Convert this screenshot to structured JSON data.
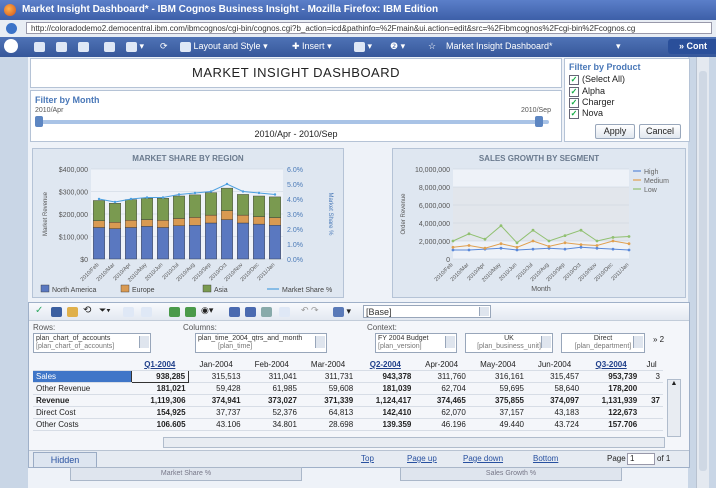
{
  "window": {
    "title": "Market Insight Dashboard* - IBM Cognos Business Insight - Mozilla Firefox: IBM Edition",
    "url": "http://coloradodemo2.democentral.ibm.com/ibmcognos/cgi-bin/cognos.cgi?b_action=icd&pathinfo=%2Fmain&ui.action=edit&src=%2Fibmcognos%2Fcgi-bin%2Fcognos.cg"
  },
  "toolbar": {
    "layout_style": "Layout and Style",
    "insert": "Insert",
    "doc_title": "Market Insight Dashboard*",
    "cont": "» Cont"
  },
  "header": {
    "title": "MARKET INSIGHT DASHBOARD"
  },
  "month_filter": {
    "label": "Filter by Month",
    "start": "2010/Apr",
    "end": "2010/Sep",
    "range": "2010/Apr - 2010/Sep"
  },
  "product_filter": {
    "label": "Filter by Product",
    "options": [
      {
        "label": "(Select All)",
        "checked": "✓"
      },
      {
        "label": "Alpha",
        "checked": "✓"
      },
      {
        "label": "Charger",
        "checked": "✓"
      },
      {
        "label": "Nova",
        "checked": "✓"
      }
    ],
    "apply": "Apply",
    "cancel": "Cancel"
  },
  "colors": {
    "north_america": "#5a78c0",
    "europe": "#d99a52",
    "asia": "#7a9a50",
    "market_share": "#4da0e0",
    "high": "#5a88d8",
    "medium": "#e0a050",
    "low": "#90c070"
  },
  "chart_data": [
    {
      "type": "bar",
      "title": "MARKET SHARE BY REGION",
      "ylabel": "Market Revenue",
      "y2label": "Market Share %",
      "ylim": [
        0,
        400000
      ],
      "y2lim": [
        0,
        6
      ],
      "yticks": [
        "$400,000",
        "$300,000",
        "$200,000",
        "$100,000",
        "$0"
      ],
      "y2ticks": [
        "6.0%",
        "5.0%",
        "4.0%",
        "3.0%",
        "2.0%",
        "1.0%",
        "0.0%"
      ],
      "categories": [
        "2010/Feb",
        "2010/Mar",
        "2010/Apr",
        "2010/May",
        "2010/Jun",
        "2010/Jul",
        "2010/Aug",
        "2010/Sep",
        "2010/Oct",
        "2010/Nov",
        "2010/Dec",
        "2011/Jan"
      ],
      "series": [
        {
          "name": "North America",
          "values": [
            140000,
            135000,
            140000,
            145000,
            140000,
            148000,
            150000,
            160000,
            175000,
            160000,
            155000,
            150000
          ]
        },
        {
          "name": "Europe",
          "values": [
            30000,
            28000,
            32000,
            30000,
            32000,
            32000,
            35000,
            35000,
            40000,
            35000,
            33000,
            34000
          ]
        },
        {
          "name": "Asia",
          "values": [
            90000,
            85000,
            92000,
            95000,
            98000,
            100000,
            100000,
            100000,
            100000,
            92000,
            92000,
            92000
          ]
        }
      ],
      "line": {
        "name": "Market Share %",
        "values": [
          4.0,
          3.8,
          4.0,
          4.1,
          4.1,
          4.3,
          4.4,
          4.5,
          5.0,
          4.5,
          4.4,
          4.3
        ]
      },
      "legend": [
        "North America",
        "Europe",
        "Asia",
        "Market Share %"
      ]
    },
    {
      "type": "line",
      "title": "SALES GROWTH BY SEGMENT",
      "ylabel": "Order Revenue",
      "xlabel": "Month",
      "ylim": [
        0,
        10000000
      ],
      "yticks": [
        "10,000,000",
        "8,000,000",
        "6,000,000",
        "4,000,000",
        "2,000,000",
        "0"
      ],
      "categories": [
        "2010/Feb",
        "2010/Mar",
        "2010/Apr",
        "2010/May",
        "2010/Jun",
        "2010/Jul",
        "2010/Aug",
        "2010/Sep",
        "2010/Oct",
        "2010/Nov",
        "2010/Dec",
        "2011/Jan"
      ],
      "series": [
        {
          "name": "High",
          "values": [
            1000000,
            1000000,
            1100000,
            1200000,
            1000000,
            1100000,
            1200000,
            1100000,
            1300000,
            1200000,
            1100000,
            1000000
          ]
        },
        {
          "name": "Medium",
          "values": [
            1300000,
            1500000,
            1200000,
            1700000,
            1300000,
            2000000,
            1400000,
            1800000,
            1600000,
            1500000,
            2000000,
            1700000
          ]
        },
        {
          "name": "Low",
          "values": [
            2000000,
            2800000,
            2200000,
            3700000,
            1800000,
            3200000,
            2000000,
            2600000,
            3200000,
            2000000,
            2400000,
            2500000
          ]
        }
      ],
      "legend": [
        "High",
        "Medium",
        "Low"
      ]
    }
  ],
  "grid": {
    "base": "[Base]",
    "rows_label": "Rows:",
    "rows_value": "plan_chart_of_accounts",
    "rows_sub": "[plan_chart_of_accounts]",
    "cols_label": "Columns:",
    "cols_value": "plan_time_2004_qtrs_and_month",
    "cols_sub": "[plan_time]",
    "context_label": "Context:",
    "ctx1": "FY 2004 Budget",
    "ctx1_sub": "[plan_version]",
    "ctx2": "UK",
    "ctx2_sub": "[plan_business_unit]",
    "ctx3": "Direct",
    "ctx3_sub": "[plan_department]",
    "ctx_more": "2",
    "column_headers": [
      {
        "label": "Q1-2004",
        "q": true
      },
      {
        "label": "Jan-2004"
      },
      {
        "label": "Feb-2004"
      },
      {
        "label": "Mar-2004"
      },
      {
        "label": "Q2-2004",
        "q": true
      },
      {
        "label": "Apr-2004"
      },
      {
        "label": "May-2004"
      },
      {
        "label": "Jun-2004"
      },
      {
        "label": "Q3-2004",
        "q": true
      },
      {
        "label": "Jul"
      }
    ],
    "rows": [
      {
        "label": "Sales",
        "cells": [
          "938,285",
          "315,513",
          "311,041",
          "311,731",
          "943,378",
          "311,760",
          "316,161",
          "315,457",
          "953,739",
          "3"
        ]
      },
      {
        "label": "Other Revenue",
        "cells": [
          "181,021",
          "59,428",
          "61,985",
          "59,608",
          "181,039",
          "62,704",
          "59,695",
          "58,640",
          "178,200",
          ""
        ]
      },
      {
        "label": "Revenue",
        "cells": [
          "1,119,306",
          "374,941",
          "373,027",
          "371,339",
          "1,124,417",
          "374,465",
          "375,855",
          "374,097",
          "1,131,939",
          "37"
        ]
      },
      {
        "label": "Direct Cost",
        "cells": [
          "154,925",
          "37,737",
          "52,376",
          "64,813",
          "142,410",
          "62,070",
          "37,157",
          "43,183",
          "122,673",
          ""
        ]
      },
      {
        "label": "Other Costs",
        "cells": [
          "106.605",
          "43.106",
          "34.801",
          "28.698",
          "139.359",
          "46.196",
          "49.440",
          "43.724",
          "157.706",
          ""
        ]
      }
    ],
    "footer": {
      "hidden": "Hidden",
      "top": "Top",
      "page_up": "Page up",
      "page_down": "Page down",
      "bottom": "Bottom",
      "page_label": "Page",
      "page_value": "1",
      "of": "of 1"
    }
  },
  "underlay": {
    "left": "Market Share %",
    "right": "Sales Growth %"
  }
}
